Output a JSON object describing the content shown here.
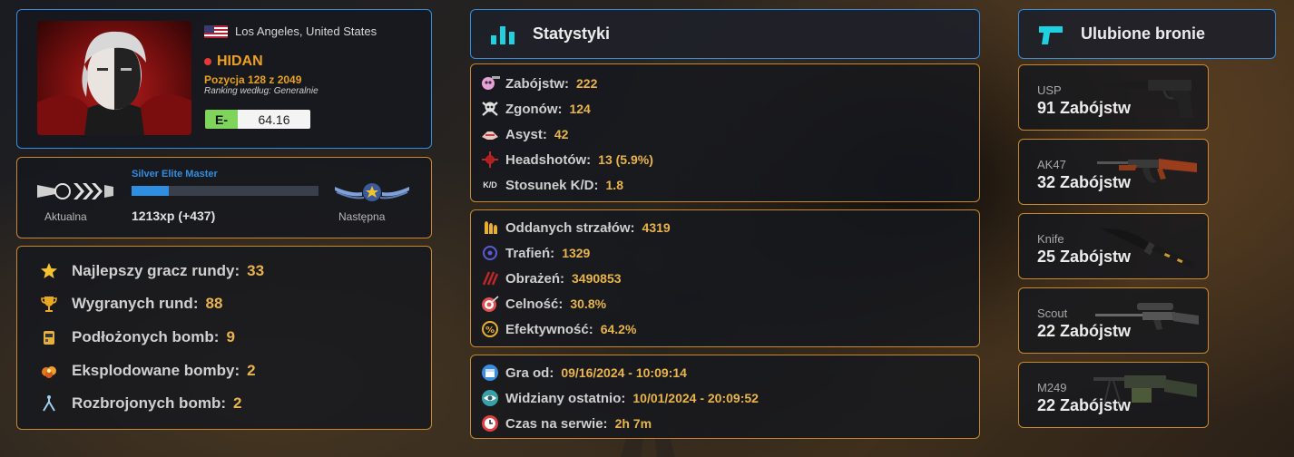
{
  "profile": {
    "location": "Los Angeles, United States",
    "player_name": "HIDAN",
    "position": "Pozycja 128 z 2049",
    "ranking_basis": "Ranking według: Generalnie",
    "elo_grade": "E-",
    "elo_value": "64.16"
  },
  "rank": {
    "name": "Silver Elite Master",
    "current_label": "Aktualna",
    "next_label": "Następna",
    "xp": "1213xp (+437)",
    "progress": 0.2
  },
  "achievements": [
    {
      "label": "Najlepszy gracz rundy:",
      "value": "33",
      "icon": "star-icon"
    },
    {
      "label": "Wygranych rund:",
      "value": "88",
      "icon": "trophy-icon"
    },
    {
      "label": "Podłożonych bomb:",
      "value": "9",
      "icon": "bomb-icon"
    },
    {
      "label": "Eksplodowane bomby:",
      "value": "2",
      "icon": "explosion-icon"
    },
    {
      "label": "Rozbrojonych bomb:",
      "value": "2",
      "icon": "defuse-icon"
    }
  ],
  "stats_header": {
    "title": "Statystyki"
  },
  "stats_combat": [
    {
      "label": "Zabójstw:",
      "value": "222",
      "icon": "skull-gun-icon"
    },
    {
      "label": "Zgonów:",
      "value": "124",
      "icon": "skull-crossbones-icon"
    },
    {
      "label": "Asyst:",
      "value": "42",
      "icon": "handshake-icon"
    },
    {
      "label": "Headshotów:",
      "value": "13 (5.9%)",
      "icon": "headshot-icon"
    },
    {
      "label": "Stosunek K/D:",
      "value": "1.8",
      "icon": "kd-icon"
    }
  ],
  "kd_icon_text": "K/D",
  "stats_accuracy": [
    {
      "label": "Oddanych strzałów:",
      "value": "4319",
      "icon": "bullets-icon"
    },
    {
      "label": "Trafień:",
      "value": "1329",
      "icon": "crosshair-icon"
    },
    {
      "label": "Obrażeń:",
      "value": "3490853",
      "icon": "damage-icon"
    },
    {
      "label": "Celność:",
      "value": "30.8%",
      "icon": "target-icon"
    },
    {
      "label": "Efektywność:",
      "value": "64.2%",
      "icon": "efficiency-icon"
    }
  ],
  "stats_time": [
    {
      "label": "Gra od:",
      "value": "09/16/2024 - 10:09:14",
      "icon": "calendar-icon"
    },
    {
      "label": "Widziany ostatnio:",
      "value": "10/01/2024 - 20:09:52",
      "icon": "eye-icon"
    },
    {
      "label": "Czas na serwie:",
      "value": "2h 7m",
      "icon": "clock-icon"
    }
  ],
  "weapons_header": {
    "title": "Ulubione bronie"
  },
  "weapons": [
    {
      "name": "USP",
      "kills": "91 Zabójstw"
    },
    {
      "name": "AK47",
      "kills": "32 Zabójstw"
    },
    {
      "name": "Knife",
      "kills": "25 Zabójstw"
    },
    {
      "name": "Scout",
      "kills": "22 Zabójstw"
    },
    {
      "name": "M249",
      "kills": "22 Zabójstw"
    }
  ],
  "colors": {
    "accent_blue": "#2f8ee0",
    "accent_orange": "#c9892a",
    "value_gold": "#e9b44c",
    "weapon_icon_cyan": "#1fd1e0"
  }
}
